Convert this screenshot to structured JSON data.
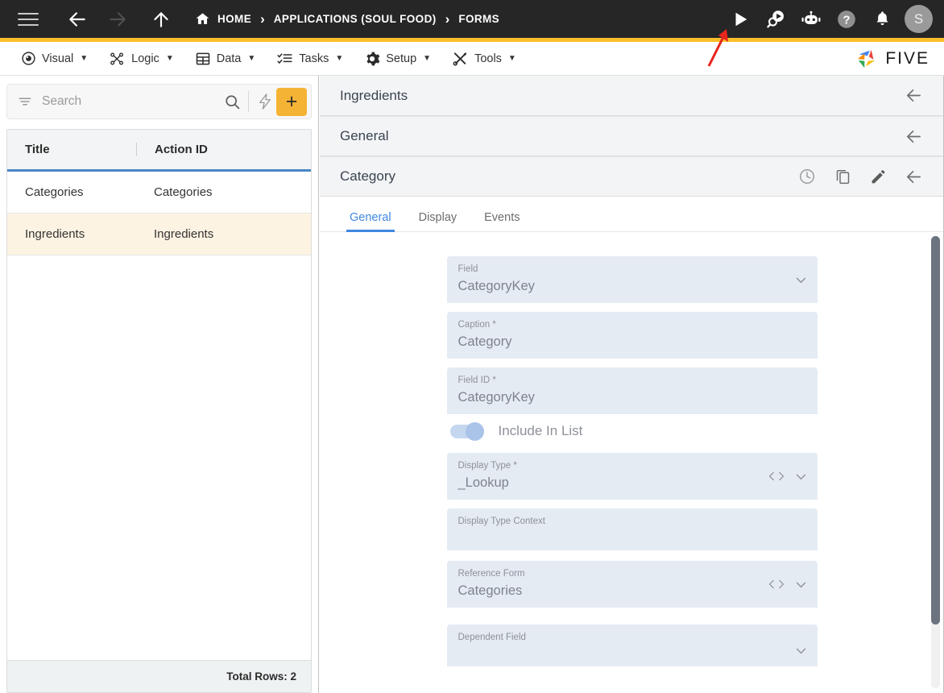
{
  "topbar": {
    "menu_icon": "hamburger-icon",
    "back_icon": "arrow-left-icon",
    "forward_icon": "arrow-right-icon",
    "up_icon": "arrow-up-icon",
    "home_icon": "home-icon",
    "breadcrumbs": [
      {
        "label": "HOME",
        "has_icon": true
      },
      {
        "label": "APPLICATIONS (SOUL FOOD)",
        "has_icon": false
      },
      {
        "label": "FORMS",
        "has_icon": false
      }
    ],
    "separator": "›",
    "actions": [
      {
        "name": "run-button",
        "icon": "play-icon"
      },
      {
        "name": "search-chat-button",
        "icon": "search-chat-icon"
      },
      {
        "name": "assistant-button",
        "icon": "robot-icon"
      },
      {
        "name": "help-button",
        "icon": "help-circle-icon"
      },
      {
        "name": "notifications-button",
        "icon": "bell-icon"
      }
    ],
    "avatar_initial": "S",
    "accent_color": "#fbbf2b",
    "background_color": "#262626"
  },
  "menubar": {
    "items": [
      {
        "label": "Visual",
        "icon": "eye-icon",
        "caret": "▼"
      },
      {
        "label": "Logic",
        "icon": "logic-nodes-icon",
        "caret": "▼"
      },
      {
        "label": "Data",
        "icon": "table-grid-icon",
        "caret": "▼"
      },
      {
        "label": "Tasks",
        "icon": "checklist-icon",
        "caret": "▼"
      },
      {
        "label": "Setup",
        "icon": "gear-icon",
        "caret": "▼"
      },
      {
        "label": "Tools",
        "icon": "tools-icon",
        "caret": "▼"
      }
    ],
    "logo_text": "FIVE"
  },
  "sidebar": {
    "search": {
      "placeholder": "Search",
      "value": ""
    },
    "filter_icon": "filter-icon",
    "search_icon": "search-icon",
    "lightning_icon": "lightning-bolt-icon",
    "add_label": "+",
    "add_color": "#f5b335",
    "grid": {
      "columns": [
        "Title",
        "Action ID"
      ],
      "rows": [
        {
          "title": "Categories",
          "action_id": "Categories",
          "selected": false
        },
        {
          "title": "Ingredients",
          "action_id": "Ingredients",
          "selected": true
        }
      ],
      "footer": "Total Rows: 2"
    }
  },
  "main": {
    "sections": [
      {
        "title": "Ingredients",
        "actions": [
          "arrow-left-icon"
        ]
      },
      {
        "title": "General",
        "actions": [
          "arrow-left-icon"
        ]
      },
      {
        "title": "Category",
        "actions": [
          "history-clock-icon",
          "copy-icon",
          "edit-pencil-icon",
          "arrow-left-icon"
        ]
      }
    ],
    "tabs": [
      {
        "label": "General",
        "active": true
      },
      {
        "label": "Display",
        "active": false
      },
      {
        "label": "Events",
        "active": false
      }
    ],
    "active_tab_color": "#3f87e0",
    "form": {
      "fields": [
        {
          "label": "Field",
          "value": "CategoryKey",
          "icons": [
            "chevron-down-icon"
          ],
          "type": "select"
        },
        {
          "label": "Caption *",
          "value": "Category",
          "icons": [],
          "type": "text"
        },
        {
          "label": "Field ID *",
          "value": "CategoryKey",
          "icons": [],
          "type": "text"
        },
        {
          "label": "Display Type *",
          "value": "_Lookup",
          "icons": [
            "code-icon",
            "chevron-down-icon"
          ],
          "type": "select"
        },
        {
          "label": "Display Type Context",
          "value": "",
          "icons": [],
          "type": "text"
        },
        {
          "label": "Reference Form",
          "value": "Categories",
          "icons": [
            "code-icon",
            "chevron-down-icon"
          ],
          "type": "select"
        },
        {
          "label": "Dependent Field",
          "value": "",
          "icons": [
            "chevron-down-icon"
          ],
          "type": "select"
        }
      ],
      "toggle": {
        "label": "Include In List",
        "on": true
      }
    }
  },
  "annotation": {
    "type": "red-arrow",
    "points_to": "run-button",
    "color": "#e8251e"
  }
}
